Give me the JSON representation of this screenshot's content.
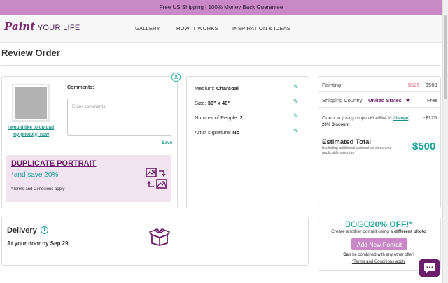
{
  "banner": {
    "text": "Free US Shipping | 100% Money Back Guarantee"
  },
  "logo": {
    "paint": "Paint",
    "your_life": "YOUR LIFE"
  },
  "nav": {
    "items": [
      "GALLERY",
      "HOW IT WORKS",
      "INSPIRATION & IDEAS"
    ]
  },
  "page": {
    "title": "Review Order"
  },
  "upload": {
    "link_label": "I would like to upload my photo(s) now",
    "comments_label": "Comments:",
    "comments_placeholder": "Enter comments",
    "save_label": "Save",
    "close_label": "X"
  },
  "duplicate": {
    "title": "DUPLICATE PORTRAIT",
    "subtitle": "*and save 20%",
    "terms": "*Terms and Conditions apply"
  },
  "specs": [
    {
      "label": "Medium: ",
      "value": "Charcoal"
    },
    {
      "label": "Size: ",
      "value": "30\" x 40\""
    },
    {
      "label": "Number of People: ",
      "value": "2"
    },
    {
      "label": "Artist signature: ",
      "value": "No"
    }
  ],
  "summary": {
    "painting_label": "Painting",
    "painting_old_price": "$625",
    "painting_price": "$500",
    "shipping_label": "Shipping Country",
    "shipping_country": "United States",
    "shipping_value": "Free",
    "coupon_label": "Coupon",
    "coupon_note": "(Using coupon KLARNA20.",
    "coupon_change": "Change",
    "coupon_close": ")",
    "coupon_discount_label": "20% Discount",
    "coupon_value": "-$125",
    "estimated_label": "Estimated Total",
    "estimated_note": "Excluding additional optional services and applicable sales tax",
    "estimated_value": "$500"
  },
  "delivery": {
    "title": "Delivery",
    "info": "i",
    "date_text": "At your door by Sep 29"
  },
  "bogo": {
    "prefix": "BOGO",
    "percent": "20% OFF!",
    "suffix": "*",
    "sub_text": "Create another portrait using a ",
    "sub_bold": "different photo",
    "button_label": "Add New Portrait",
    "combine_bold": "Can",
    "combine_text": " be combined with any other offer!",
    "terms": "*Terms and Conditions apply"
  },
  "colors": {
    "brand_purple": "#6a1d69",
    "accent_teal": "#1aa09a",
    "banner_pink": "#c889c6"
  },
  "icons": {
    "edit": "pencil-icon",
    "close": "close-icon",
    "info": "info-icon",
    "gift_box": "gift-box-icon",
    "duplicate": "duplicate-photos-icon",
    "chat": "chat-icon"
  }
}
